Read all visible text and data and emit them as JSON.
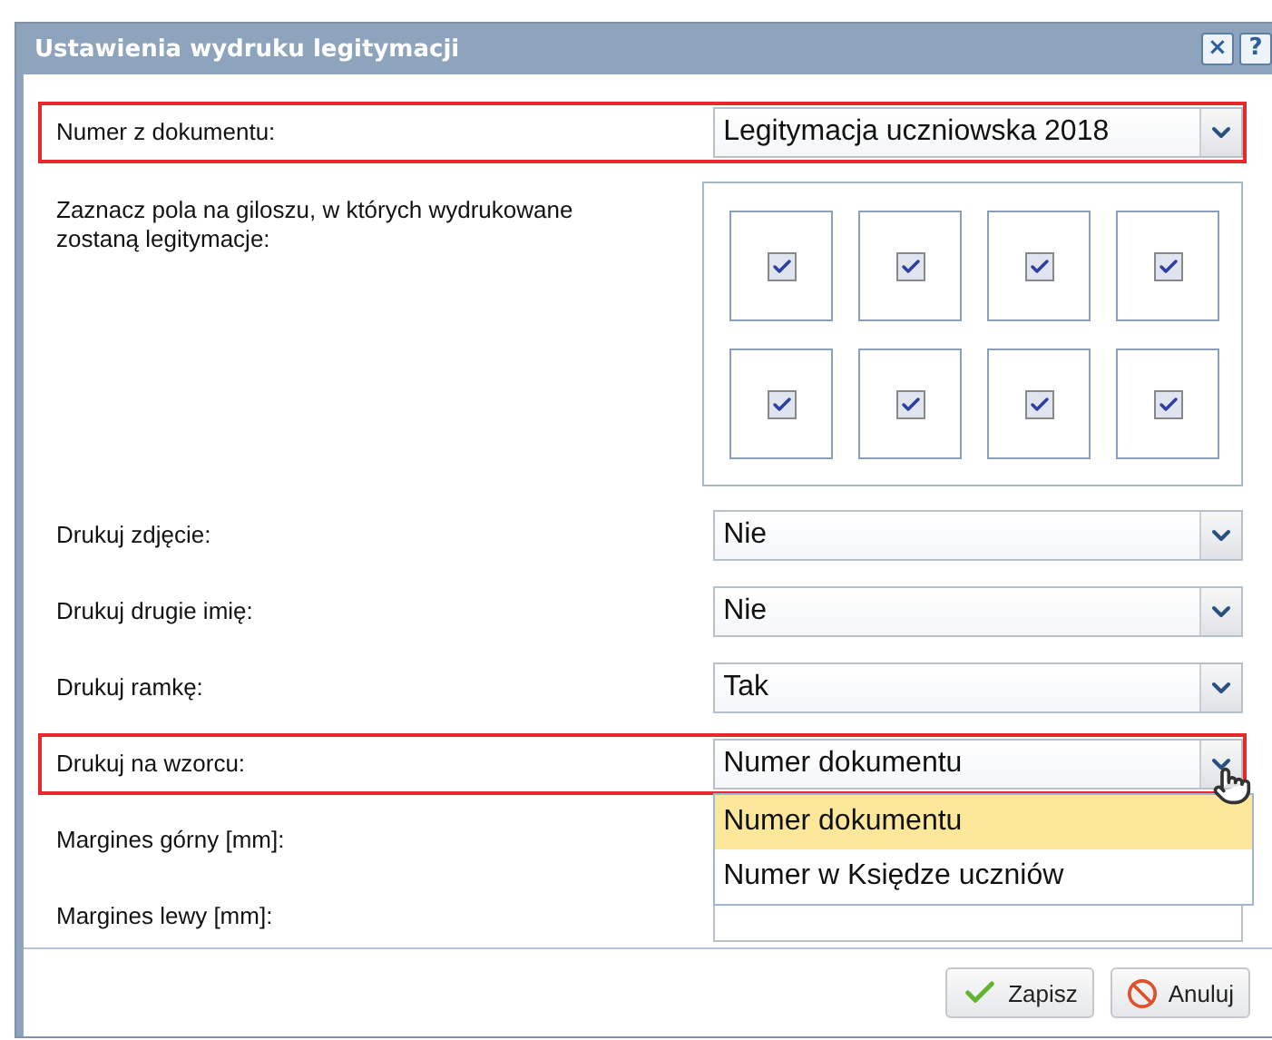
{
  "window": {
    "title": "Ustawienia wydruku legitymacji",
    "buttons": [
      "×",
      "?"
    ]
  },
  "rows": [
    {
      "kind": "select",
      "label": "Numer z dokumentu:",
      "value": "Legitymacja uczniowska 2018",
      "highlighted": true,
      "expanded": false
    },
    {
      "kind": "grid",
      "label": "Zaznacz pola na giloszu, w których wydrukowane zostaną legitymacje:",
      "cells": [
        {
          "checked": true
        },
        {
          "checked": true
        },
        {
          "checked": true
        },
        {
          "checked": true
        },
        {
          "checked": true
        },
        {
          "checked": true
        },
        {
          "checked": true
        },
        {
          "checked": true
        }
      ]
    },
    {
      "kind": "select",
      "label": "Drukuj zdjęcie:",
      "value": "Nie",
      "highlighted": false,
      "expanded": false
    },
    {
      "kind": "select",
      "label": "Drukuj drugie imię:",
      "value": "Nie",
      "highlighted": false,
      "expanded": false
    },
    {
      "kind": "select",
      "label": "Drukuj ramkę:",
      "value": "Tak",
      "highlighted": false,
      "expanded": false
    },
    {
      "kind": "select",
      "label": "Drukuj na wzorcu:",
      "value": "Numer dokumentu",
      "highlighted": true,
      "expanded": true,
      "options": [
        {
          "label": "Numer dokumentu",
          "selected": true
        },
        {
          "label": "Numer w Księdze uczniów",
          "selected": false
        }
      ]
    },
    {
      "kind": "label",
      "label": "Margines górny [mm]:"
    },
    {
      "kind": "input",
      "label": "Margines lewy [mm]:"
    }
  ],
  "footer": {
    "buttons": [
      {
        "kind": "save",
        "label": "Zapisz"
      },
      {
        "kind": "cancel",
        "label": "Anuluj"
      }
    ]
  }
}
